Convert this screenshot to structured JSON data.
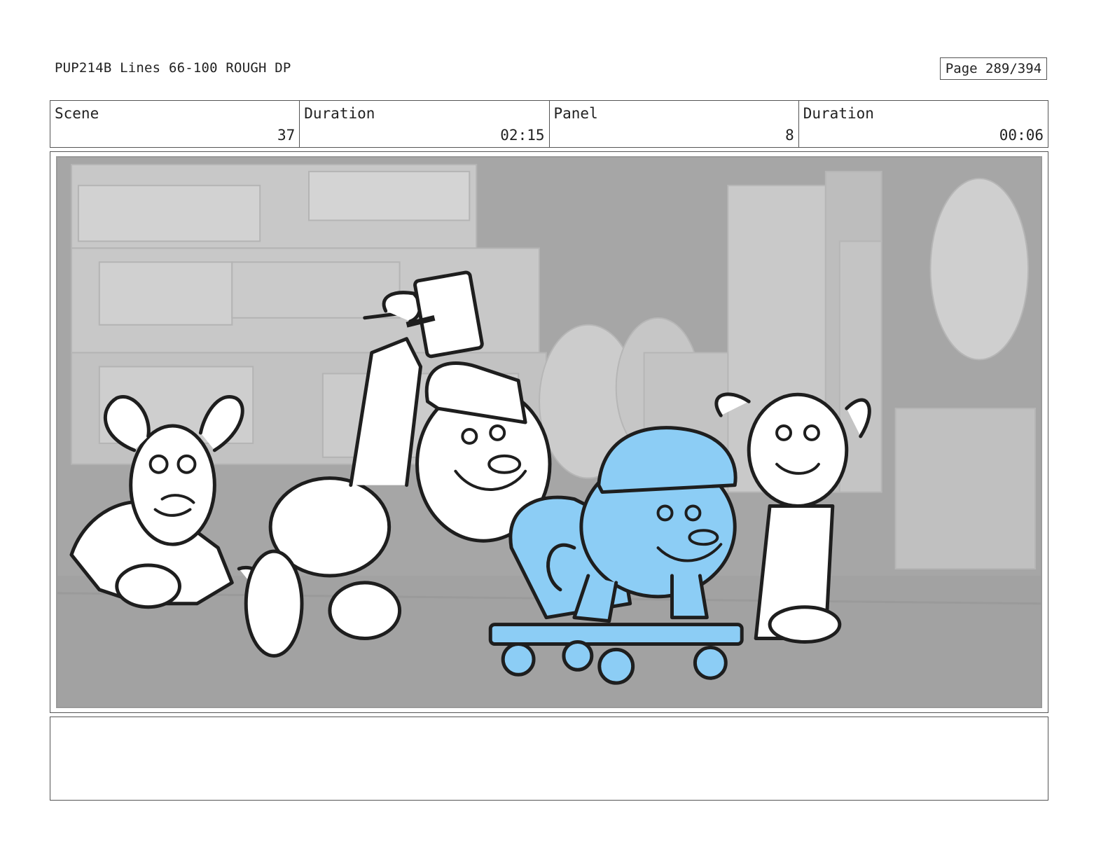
{
  "header": {
    "title": "PUP214B Lines 66-100 ROUGH DP",
    "page": "Page 289/394"
  },
  "info": {
    "scene_label": "Scene",
    "scene_value": "37",
    "scene_duration_label": "Duration",
    "scene_duration_value": "02:15",
    "panel_label": "Panel",
    "panel_value": "8",
    "panel_duration_label": "Duration",
    "panel_duration_value": "00:06"
  },
  "panel": {
    "content": "storyboard sketch of four puppies in hard hats on a city street; one holds a hammer, one rides a wheeled dolly",
    "highlight_color": "#8ccdf5",
    "background_tone": "#a9a9a9"
  },
  "notes": {
    "text": ""
  }
}
